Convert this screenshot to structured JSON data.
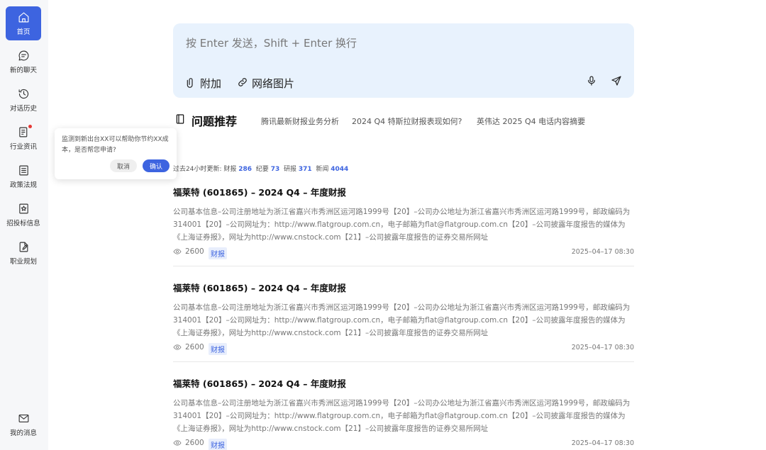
{
  "sidebar": {
    "items": [
      {
        "label": "首页",
        "icon": "home-icon",
        "active": true
      },
      {
        "label": "新的聊天",
        "icon": "chat-icon"
      },
      {
        "label": "对话历史",
        "icon": "history-icon"
      },
      {
        "label": "行业资讯",
        "icon": "news-icon",
        "badge": true
      },
      {
        "label": "政策法规",
        "icon": "policy-icon"
      },
      {
        "label": "招投标信息",
        "icon": "bidding-icon"
      },
      {
        "label": "职业规划",
        "icon": "career-icon"
      }
    ],
    "bottom": {
      "label": "我的消息",
      "icon": "mail-icon"
    }
  },
  "popover": {
    "message": "监测到新出台XX可以帮助你节约XX成本，是否帮您申请?",
    "cancel": "取消",
    "confirm": "确认"
  },
  "chat_input": {
    "placeholder": "按 Enter 发送，Shift + Enter 换行",
    "attach_label": "附加",
    "web_image_label": "网络图片"
  },
  "questions": {
    "title": "问题推荐",
    "items": [
      "腾讯最新财报业务分析",
      "2024 Q4 特斯拉财报表现如何?",
      "英伟达 2025 Q4 电话内容摘要"
    ]
  },
  "stats": {
    "prefix": "过去24小时更新:",
    "items": [
      {
        "label": "财报",
        "value": "286"
      },
      {
        "label": "纪要",
        "value": "73"
      },
      {
        "label": "研报",
        "value": "371"
      },
      {
        "label": "新闻",
        "value": "4044"
      }
    ]
  },
  "articles": [
    {
      "title": "福莱特 (601865) – 2024 Q4 – 年度财报",
      "body": "公司基本信息–公司注册地址为浙江省嘉兴市秀洲区运河路1999号【20】–公司办公地址为浙江省嘉兴市秀洲区运河路1999号，邮政编码为314001【20】–公司网址为：http://www.flatgroup.com.cn，电子邮箱为flat@flatgroup.com.cn【20】–公司披露年度报告的媒体为《上海证券报》，网址为http://www.cnstock.com【21】–公司披露年度报告的证券交易所网址",
      "views": "2600",
      "tag": "财报",
      "date": "2025–04–17 08:30"
    },
    {
      "title": "福莱特 (601865) – 2024 Q4 – 年度财报",
      "body": "公司基本信息–公司注册地址为浙江省嘉兴市秀洲区运河路1999号【20】–公司办公地址为浙江省嘉兴市秀洲区运河路1999号，邮政编码为314001【20】–公司网址为：http://www.flatgroup.com.cn，电子邮箱为flat@flatgroup.com.cn【20】–公司披露年度报告的媒体为《上海证券报》，网址为http://www.cnstock.com【21】–公司披露年度报告的证券交易所网址",
      "views": "2600",
      "tag": "财报",
      "date": "2025–04–17 08:30"
    },
    {
      "title": "福莱特 (601865) – 2024 Q4 – 年度财报",
      "body": "公司基本信息–公司注册地址为浙江省嘉兴市秀洲区运河路1999号【20】–公司办公地址为浙江省嘉兴市秀洲区运河路1999号，邮政编码为314001【20】–公司网址为：http://www.flatgroup.com.cn，电子邮箱为flat@flatgroup.com.cn【20】–公司披露年度报告的媒体为《上海证券报》，网址为http://www.cnstock.com【21】–公司披露年度报告的证券交易所网址",
      "views": "2600",
      "tag": "财报",
      "date": "2025–04–17 08:30"
    }
  ],
  "colors": {
    "accent": "#3d64e0",
    "input_bg": "#e8f2fd",
    "sidebar_bg": "#f6f7f9"
  }
}
